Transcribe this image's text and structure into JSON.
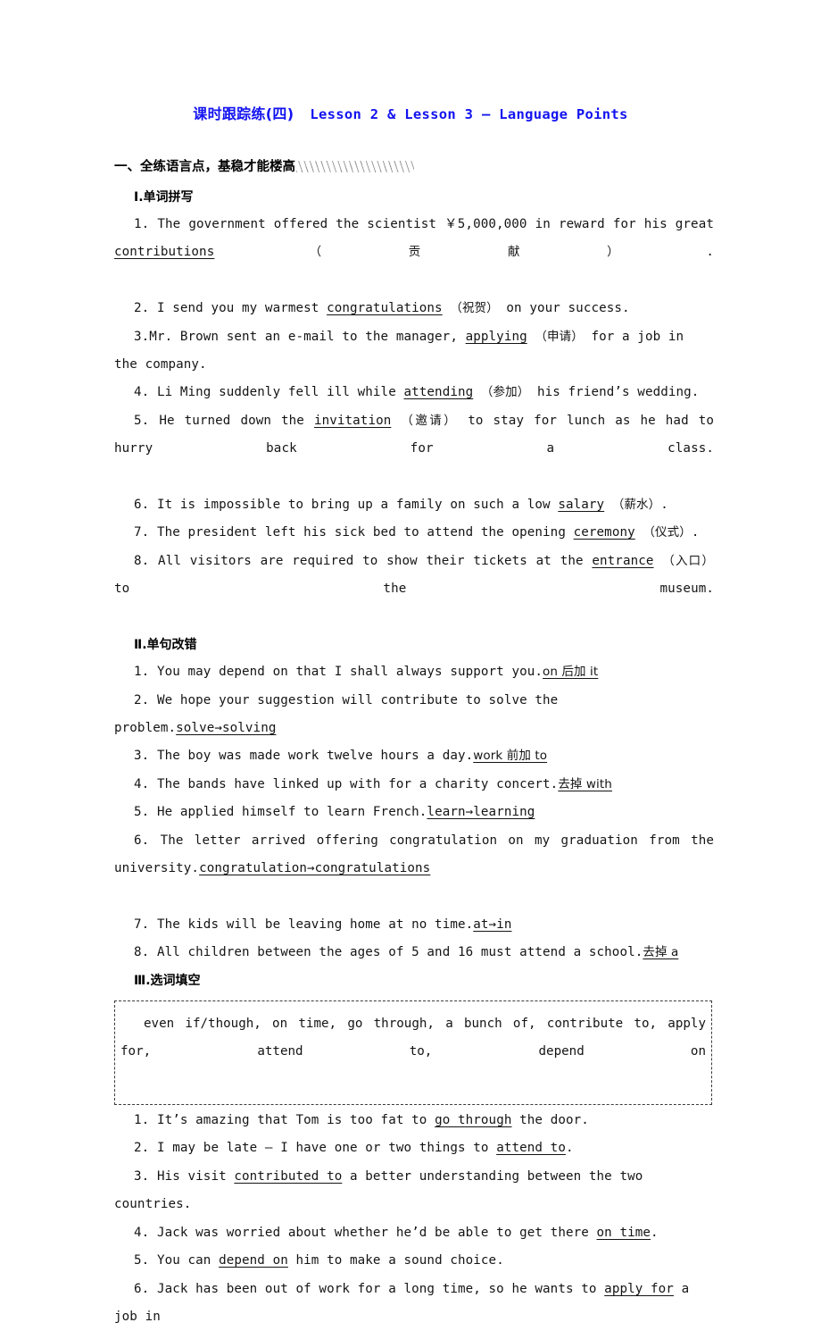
{
  "title": {
    "cn": "课时跟踪练(四)",
    "en": "Lesson 2 & Lesson 3 — Language Points",
    "color": "#1313f0"
  },
  "section_one": {
    "heading": "一、全练语言点，基稳才能楼高",
    "part_1": {
      "label": "Ⅰ.单词拼写",
      "items": [
        {
          "num": "1.",
          "pre": "The government offered the scientist ￥5,000,000 in reward for his great ",
          "answer": "contributions",
          "gloss": "（贡献）",
          "post": "."
        },
        {
          "num": "2.",
          "pre": "I send you my warmest ",
          "answer": "congratulations",
          "gloss": "（祝贺）",
          "post": " on your success."
        },
        {
          "num": "3.",
          "pre": "Mr. Brown sent an e-mail to the manager, ",
          "answer": "applying",
          "gloss": "（申请）",
          "post": " for a job in the company."
        },
        {
          "num": "4.",
          "pre": "Li Ming suddenly fell ill while ",
          "answer": "attending",
          "gloss": "（参加）",
          "post": " his friend’s wedding."
        },
        {
          "num": "5.",
          "pre": "He turned down the ",
          "answer": "invitation",
          "gloss": "（邀请）",
          "post": " to stay for lunch as he had to hurry back for a class."
        },
        {
          "num": "6.",
          "pre": "It is impossible to bring up a family on such a low ",
          "answer": "salary",
          "gloss": "（薪水）",
          "post": "."
        },
        {
          "num": "7.",
          "pre": "The president left his sick bed to attend the opening ",
          "answer": "ceremony",
          "gloss": "（仪式）",
          "post": "."
        },
        {
          "num": "8.",
          "pre": "All visitors are required to show their tickets at the ",
          "answer": "entrance",
          "gloss": "（入口）",
          "post": " to the museum."
        }
      ]
    },
    "part_2": {
      "label": "Ⅱ.单句改错",
      "items": [
        {
          "num": "1.",
          "sentence": "You may depend on that I shall always support you.",
          "correction": "on 后加 it"
        },
        {
          "num": "2.",
          "sentence": "We hope your suggestion will contribute to solve the problem.",
          "correction": "solve→solving "
        },
        {
          "num": "3.",
          "sentence": "The boy was made work twelve hours a day.",
          "correction": "work 前加 to"
        },
        {
          "num": "4.",
          "sentence": "The bands have linked up with for a charity concert.",
          "correction": "去掉 with"
        },
        {
          "num": "5.",
          "sentence": "He applied himself to learn French.",
          "correction": "learn→learning"
        },
        {
          "num": "6.",
          "sentence": "The letter arrived offering congratulation on my graduation from the university.",
          "correction": "congratulation→congratulations"
        },
        {
          "num": "7.",
          "sentence": "The kids will be leaving home at no time.",
          "correction": "at→in"
        },
        {
          "num": "8.",
          "sentence": "All children between the ages of 5 and 16 must attend a school.",
          "correction": "去掉 a"
        }
      ]
    },
    "part_3": {
      "label": "Ⅲ.选词填空",
      "word_bank": "even if/though,  on time,  go through,  a bunch of,  contribute to,  apply for,  attend to,  depend on",
      "items": [
        {
          "num": "1.",
          "pre": "It’s amazing that Tom is too fat to ",
          "answer": "go through",
          "post": " the door."
        },
        {
          "num": "2.",
          "pre": "I may be late — I have one or two things to ",
          "answer": "attend to",
          "post": "."
        },
        {
          "num": "3.",
          "pre": "His visit ",
          "answer": "contributed to",
          "post": " a better understanding between the two countries."
        },
        {
          "num": "4.",
          "pre": "Jack was worried about whether he’d be able to get there ",
          "answer": "on time",
          "post": "."
        },
        {
          "num": "5.",
          "pre": "You can ",
          "answer": "depend on",
          "post": " him to make a sound choice."
        },
        {
          "num": "6.",
          "pre": "Jack has been out of work for a long time, so he wants to ",
          "answer": "apply for",
          "post": " a job in"
        }
      ]
    }
  }
}
